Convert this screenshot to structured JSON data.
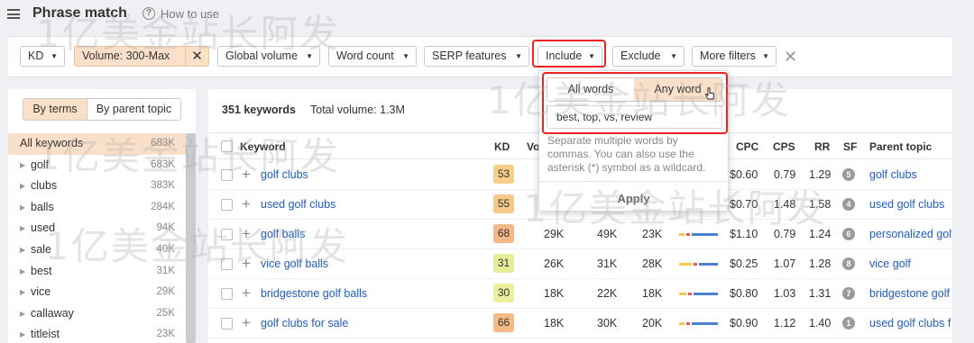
{
  "header": {
    "title": "Phrase match",
    "help_link": "How to use"
  },
  "filters": {
    "kd": "KD",
    "volume": "Volume: 300-Max",
    "global_volume": "Global volume",
    "word_count": "Word count",
    "serp_features": "SERP features",
    "include": "Include",
    "exclude": "Exclude",
    "more_filters": "More filters"
  },
  "sidebar": {
    "tabs": [
      "By terms",
      "By parent topic"
    ],
    "items": [
      {
        "label": "All keywords",
        "count": "683K"
      },
      {
        "label": "golf",
        "count": "683K"
      },
      {
        "label": "clubs",
        "count": "383K"
      },
      {
        "label": "balls",
        "count": "284K"
      },
      {
        "label": "used",
        "count": "94K"
      },
      {
        "label": "sale",
        "count": "40K"
      },
      {
        "label": "best",
        "count": "31K"
      },
      {
        "label": "vice",
        "count": "29K"
      },
      {
        "label": "callaway",
        "count": "25K"
      },
      {
        "label": "titleist",
        "count": "23K"
      }
    ]
  },
  "summary": {
    "count": "351 keywords",
    "total_volume": "Total volume: 1.3M"
  },
  "table": {
    "headers": {
      "keyword": "Keyword",
      "kd": "KD",
      "volume": "Vo",
      "cpc": "CPC",
      "cps": "CPS",
      "rr": "RR",
      "sf": "SF",
      "parent": "Parent topic"
    },
    "rows": [
      {
        "keyword": "golf clubs",
        "kd": "53",
        "kd_color": "#f6cf8a",
        "vol": "",
        "gv": "",
        "tp": "",
        "cpc": "$0.60",
        "cps": "0.79",
        "rr": "1.29",
        "sf": "5",
        "parent": "golf clubs"
      },
      {
        "keyword": "used golf clubs",
        "kd": "55",
        "kd_color": "#f6c88a",
        "vol": "",
        "gv": "",
        "tp": "",
        "cpc": "$0.70",
        "cps": "1.48",
        "rr": "1.58",
        "sf": "4",
        "parent": "used golf clubs"
      },
      {
        "keyword": "golf balls",
        "kd": "68",
        "kd_color": "#f5b887",
        "vol": "29K",
        "gv": "49K",
        "tp": "23K",
        "cpc": "$1.10",
        "cps": "0.79",
        "rr": "1.24",
        "sf": "6",
        "parent": "personalized golf"
      },
      {
        "keyword": "vice golf balls",
        "kd": "31",
        "kd_color": "#e6ec9a",
        "vol": "26K",
        "gv": "31K",
        "tp": "28K",
        "cpc": "$0.25",
        "cps": "1.07",
        "rr": "1.28",
        "sf": "8",
        "parent": "vice golf"
      },
      {
        "keyword": "bridgestone golf balls",
        "kd": "30",
        "kd_color": "#ecef9c",
        "vol": "18K",
        "gv": "22K",
        "tp": "18K",
        "cpc": "$0.80",
        "cps": "1.03",
        "rr": "1.31",
        "sf": "7",
        "parent": "bridgestone golf"
      },
      {
        "keyword": "golf clubs for sale",
        "kd": "66",
        "kd_color": "#f5b887",
        "vol": "18K",
        "gv": "30K",
        "tp": "20K",
        "cpc": "$0.90",
        "cps": "1.12",
        "rr": "1.40",
        "sf": "1",
        "parent": "used golf clubs f"
      }
    ]
  },
  "include_dropdown": {
    "tab_all": "All words",
    "tab_any": "Any word",
    "value": "best, top, vs, review",
    "help": "Separate multiple words by commas. You can also use the asterisk (*) symbol as a wildcard.",
    "apply": "Apply"
  },
  "watermark": "1亿美金站长阿发",
  "colors": {
    "accent": "#fbe0c9",
    "link": "#1f5cc4",
    "highlight": "#e22222"
  }
}
